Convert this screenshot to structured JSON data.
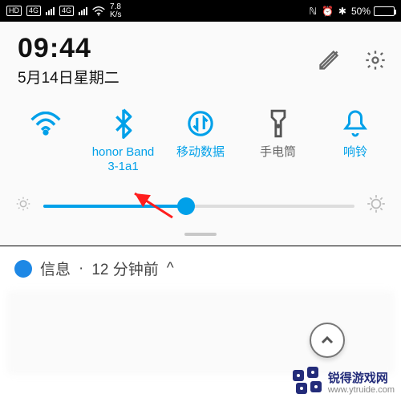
{
  "statusbar": {
    "net_badge_hd": "HD",
    "net_badge_4g1": "4G",
    "net_badge_4g2": "4G",
    "speed_top": "7.8",
    "speed_unit": "K/s",
    "nfc_glyph": "ℕ",
    "alarm_glyph": "⏰",
    "bt_glyph": "✱",
    "battery_pct": "50%"
  },
  "header": {
    "time": "09:44",
    "date": "5月14日星期二",
    "edit_icon": "pencil-icon",
    "settings_icon": "gear-icon"
  },
  "tiles": [
    {
      "id": "wifi",
      "label": "",
      "active": true
    },
    {
      "id": "bluetooth",
      "label": "honor Band 3-1a1",
      "active": true
    },
    {
      "id": "mobiledata",
      "label": "移动数据",
      "active": true
    },
    {
      "id": "flashlight",
      "label": "手电筒",
      "active": false
    },
    {
      "id": "ring",
      "label": "响铃",
      "active": true
    }
  ],
  "brightness": {
    "value_pct": 46
  },
  "notification": {
    "app": "信息",
    "sep": "·",
    "time": "12 分钟前",
    "chevron": "^"
  },
  "watermark": {
    "brand": "锐得游戏网",
    "url": "www.ytruide.com"
  }
}
